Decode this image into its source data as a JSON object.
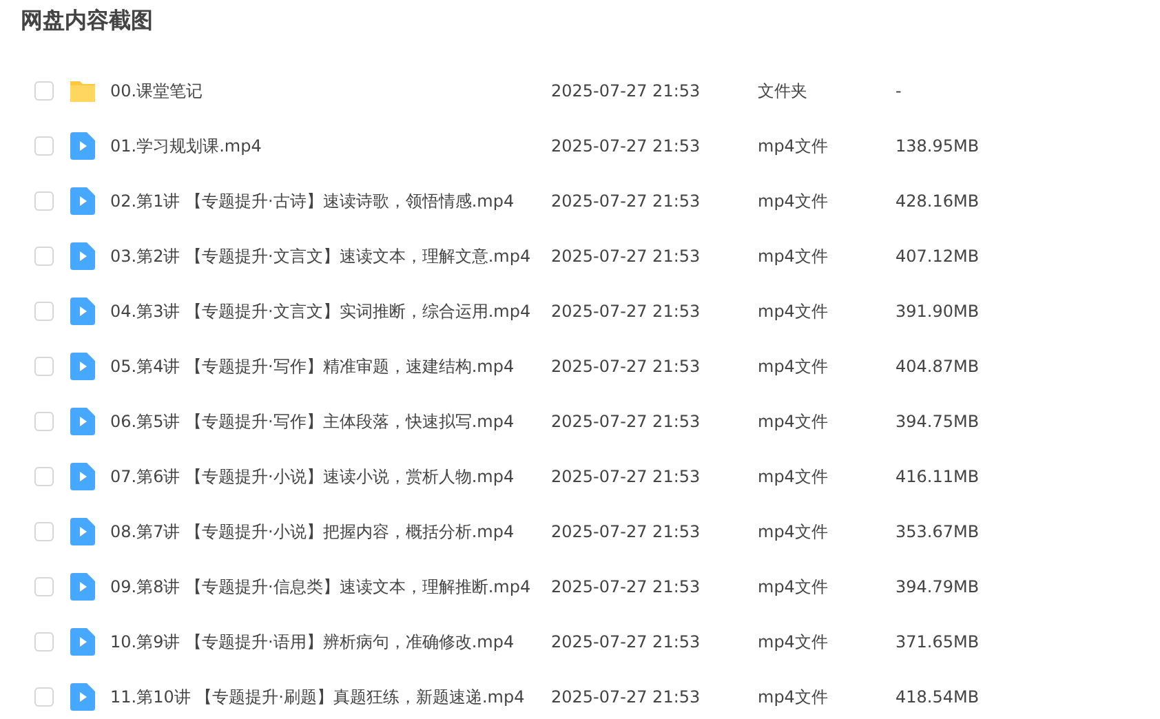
{
  "title": "网盘内容截图",
  "files": [
    {
      "kind": "folder",
      "name": "00.课堂笔记",
      "date": "2025-07-27 21:53",
      "type": "文件夹",
      "size": "-",
      "checked": false
    },
    {
      "kind": "video",
      "name": "01.学习规划课.mp4",
      "date": "2025-07-27 21:53",
      "type": "mp4文件",
      "size": "138.95MB",
      "checked": false
    },
    {
      "kind": "video",
      "name": "02.第1讲 【专题提升·古诗】速读诗歌，领悟情感.mp4",
      "date": "2025-07-27 21:53",
      "type": "mp4文件",
      "size": "428.16MB",
      "checked": false
    },
    {
      "kind": "video",
      "name": "03.第2讲 【专题提升·文言文】速读文本，理解文意.mp4",
      "date": "2025-07-27 21:53",
      "type": "mp4文件",
      "size": "407.12MB",
      "checked": false
    },
    {
      "kind": "video",
      "name": "04.第3讲 【专题提升·文言文】实词推断，综合运用.mp4",
      "date": "2025-07-27 21:53",
      "type": "mp4文件",
      "size": "391.90MB",
      "checked": false
    },
    {
      "kind": "video",
      "name": "05.第4讲 【专题提升·写作】精准审题，速建结构.mp4",
      "date": "2025-07-27 21:53",
      "type": "mp4文件",
      "size": "404.87MB",
      "checked": false
    },
    {
      "kind": "video",
      "name": "06.第5讲 【专题提升·写作】主体段落，快速拟写.mp4",
      "date": "2025-07-27 21:53",
      "type": "mp4文件",
      "size": "394.75MB",
      "checked": false
    },
    {
      "kind": "video",
      "name": "07.第6讲 【专题提升·小说】速读小说，赏析人物.mp4",
      "date": "2025-07-27 21:53",
      "type": "mp4文件",
      "size": "416.11MB",
      "checked": false
    },
    {
      "kind": "video",
      "name": "08.第7讲 【专题提升·小说】把握内容，概括分析.mp4",
      "date": "2025-07-27 21:53",
      "type": "mp4文件",
      "size": "353.67MB",
      "checked": false
    },
    {
      "kind": "video",
      "name": "09.第8讲 【专题提升·信息类】速读文本，理解推断.mp4",
      "date": "2025-07-27 21:53",
      "type": "mp4文件",
      "size": "394.79MB",
      "checked": false
    },
    {
      "kind": "video",
      "name": "10.第9讲 【专题提升·语用】辨析病句，准确修改.mp4",
      "date": "2025-07-27 21:53",
      "type": "mp4文件",
      "size": "371.65MB",
      "checked": false
    },
    {
      "kind": "video",
      "name": "11.第10讲 【专题提升·刷题】真题狂练，新题速递.mp4",
      "date": "2025-07-27 21:53",
      "type": "mp4文件",
      "size": "418.54MB",
      "checked": false
    }
  ]
}
